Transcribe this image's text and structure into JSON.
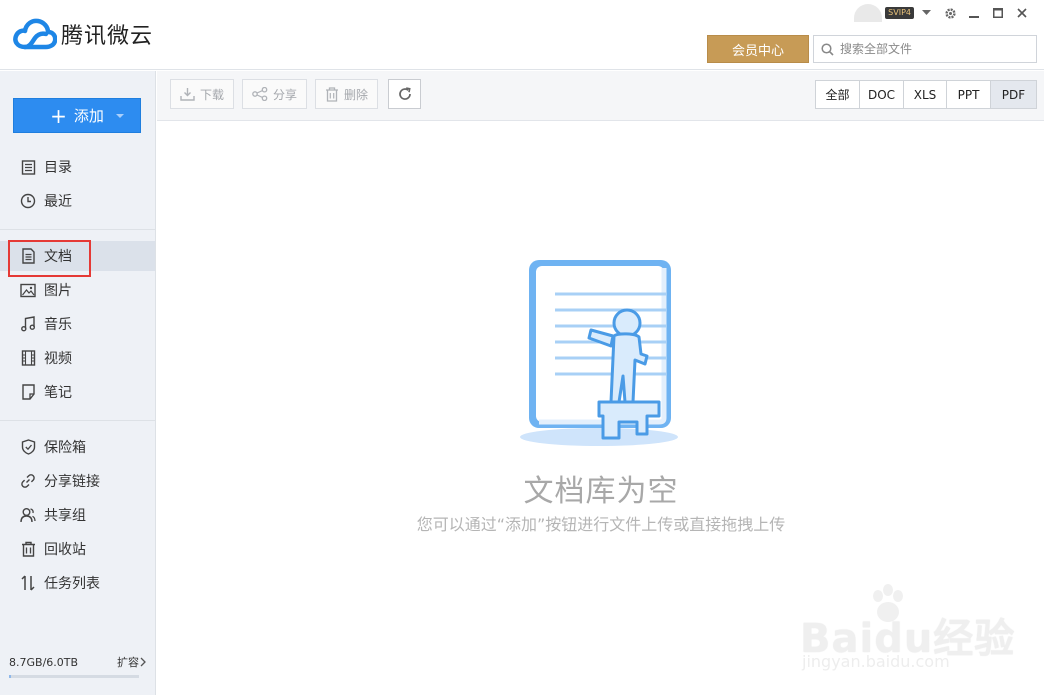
{
  "app": {
    "logo_text": "腾讯微云",
    "vip_badge": "SVIP4"
  },
  "header": {
    "member_center": "会员中心",
    "search_placeholder": "搜索全部文件"
  },
  "sidebar": {
    "add_label": "添加",
    "items": [
      {
        "label": "目录",
        "icon": "directory-icon"
      },
      {
        "label": "最近",
        "icon": "clock-icon"
      },
      {
        "label": "文档",
        "icon": "document-icon",
        "active": true
      },
      {
        "label": "图片",
        "icon": "image-icon"
      },
      {
        "label": "音乐",
        "icon": "music-icon"
      },
      {
        "label": "视频",
        "icon": "video-icon"
      },
      {
        "label": "笔记",
        "icon": "note-icon"
      },
      {
        "label": "保险箱",
        "icon": "shield-icon"
      },
      {
        "label": "分享链接",
        "icon": "link-icon"
      },
      {
        "label": "共享组",
        "icon": "group-icon"
      },
      {
        "label": "回收站",
        "icon": "trash-icon"
      },
      {
        "label": "任务列表",
        "icon": "transfer-icon"
      }
    ],
    "storage": {
      "used_total": "8.7GB/6.0TB",
      "expand_label": "扩容",
      "used_fraction": 0.0014
    }
  },
  "toolbar": {
    "download": "下载",
    "share": "分享",
    "delete": "删除",
    "filters": [
      "全部",
      "DOC",
      "XLS",
      "PPT",
      "PDF"
    ],
    "active_filter": "PDF"
  },
  "empty_state": {
    "title": "文档库为空",
    "subtitle": "您可以通过“添加”按钮进行文件上传或直接拖拽上传"
  },
  "watermark": {
    "brand": "Baidu经验",
    "url": "jingyan.baidu.com"
  },
  "colors": {
    "accent": "#2d8cf0",
    "member_gold": "#c79b56",
    "highlight_red": "#e53935",
    "sidebar_bg": "#eef1f6"
  }
}
